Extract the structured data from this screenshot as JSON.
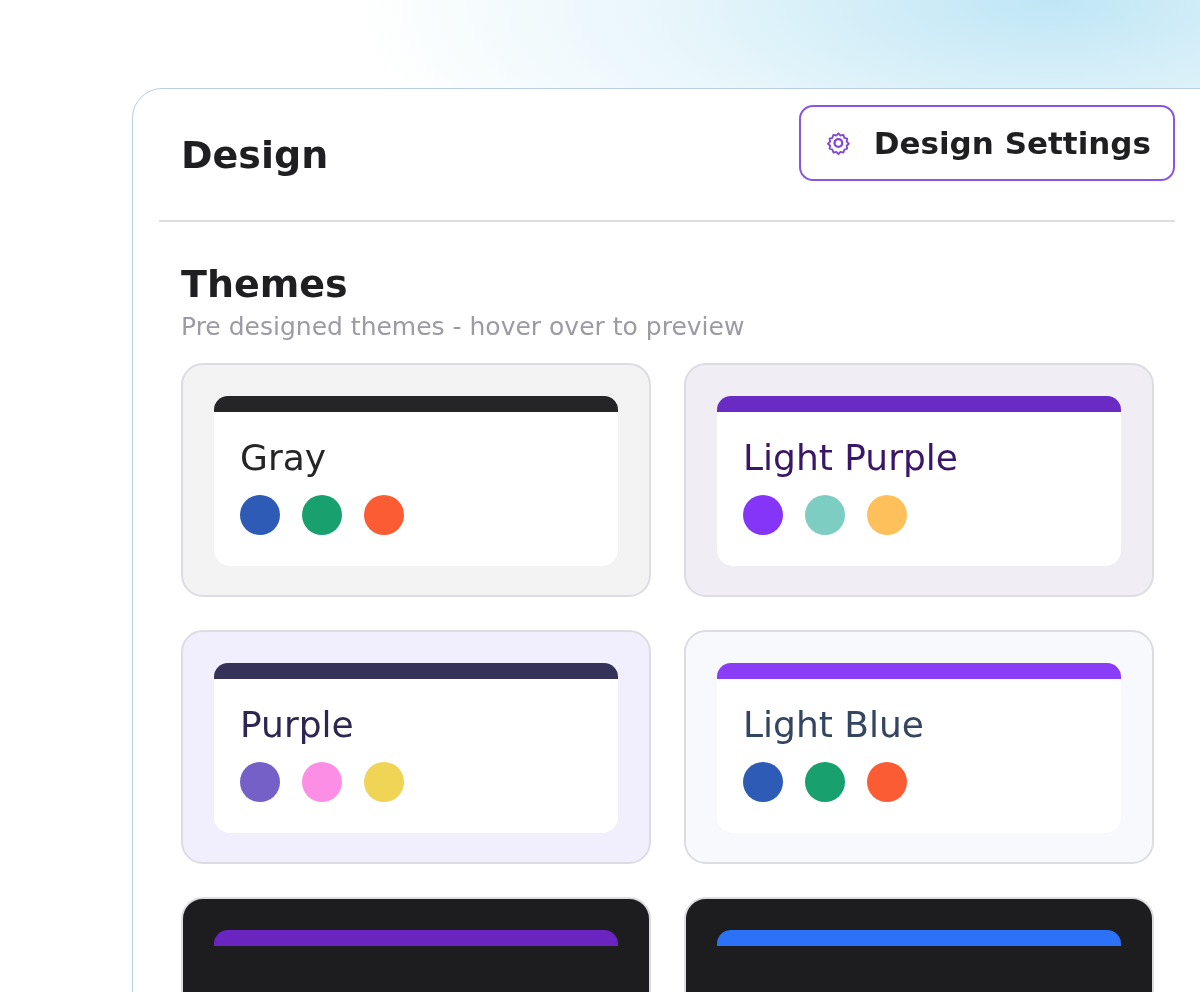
{
  "panel": {
    "title": "Design",
    "settings_button": "Design Settings"
  },
  "themes_section": {
    "title": "Themes",
    "subtitle": "Pre designed themes - hover over to preview"
  },
  "themes": [
    {
      "color": "#f3f3f4",
      "header_bar": {
        "color": "#252528"
      },
      "name": {
        "text": "Gray",
        "color": "#252528"
      },
      "swatches": [
        {
          "color": "#2d5bb5"
        },
        {
          "color": "#18a06f"
        },
        {
          "color": "#fb5c34"
        }
      ]
    },
    {
      "color": "#f0eef4",
      "header_bar": {
        "color": "#6a2bc4"
      },
      "name": {
        "text": "Light Purple",
        "color": "#3a1666"
      },
      "swatches": [
        {
          "color": "#8435f7"
        },
        {
          "color": "#7ecdc2"
        },
        {
          "color": "#fdc05a"
        }
      ]
    },
    {
      "color": "#f1effd",
      "header_bar": {
        "color": "#363158"
      },
      "name": {
        "text": "Purple",
        "color": "#2e2650"
      },
      "swatches": [
        {
          "color": "#7560c8"
        },
        {
          "color": "#fc8fe5"
        },
        {
          "color": "#efd455"
        }
      ]
    },
    {
      "color": "#f8f9fc",
      "header_bar": {
        "color": "#8a3df7"
      },
      "name": {
        "text": "Light Blue",
        "color": "#344560"
      },
      "swatches": [
        {
          "color": "#2d5bb5"
        },
        {
          "color": "#18a06f"
        },
        {
          "color": "#fb5c34"
        }
      ]
    },
    {
      "color": "#1d1d1f",
      "header_bar": {
        "color": "#6a24c0"
      }
    },
    {
      "color": "#1d1d1f",
      "header_bar": {
        "color": "#2b72f6"
      }
    }
  ]
}
